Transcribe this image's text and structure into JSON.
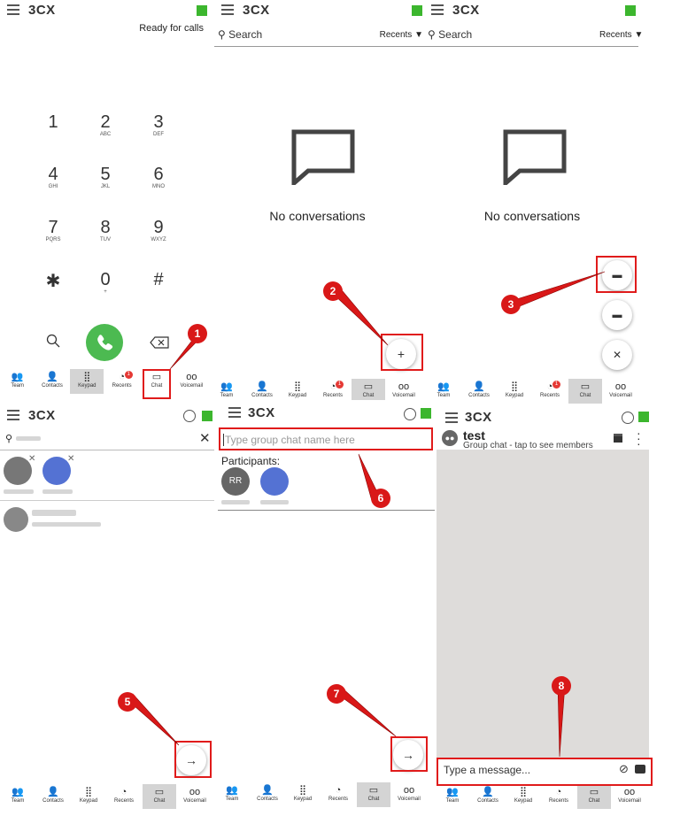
{
  "app": {
    "logo_text": "3CX"
  },
  "colors": {
    "presence": "#3cb62e",
    "call": "#4cba51",
    "marker": "#d91818",
    "avatar_blue": "#5472d3",
    "avatar_gray": "#666666"
  },
  "icons": {
    "menu": "hamburger-icon",
    "search": "search-icon",
    "back": "backspace-icon",
    "send": "arrow-right-icon"
  },
  "dialer": {
    "status": "Ready for calls",
    "keys": [
      {
        "n": "1",
        "l": ""
      },
      {
        "n": "2",
        "l": "ABC"
      },
      {
        "n": "3",
        "l": "DEF"
      },
      {
        "n": "4",
        "l": "GHI"
      },
      {
        "n": "5",
        "l": "JKL"
      },
      {
        "n": "6",
        "l": "MNO"
      },
      {
        "n": "7",
        "l": "PQRS"
      },
      {
        "n": "8",
        "l": "TUV"
      },
      {
        "n": "9",
        "l": "WXYZ"
      },
      {
        "n": "✱",
        "l": ""
      },
      {
        "n": "0",
        "l": "+"
      },
      {
        "n": "#",
        "l": ""
      }
    ]
  },
  "search": {
    "placeholder": "Search",
    "filter": "Recents"
  },
  "empty_state": "No conversations",
  "group": {
    "name_placeholder": "Type group chat name here",
    "participants_label": "Participants:",
    "avatar_initials": "RR"
  },
  "chat": {
    "title": "test",
    "subtitle": "Group chat - tap to see members",
    "message_placeholder": "Type a message..."
  },
  "nav": [
    "Team",
    "Contacts",
    "Keypad",
    "Recents",
    "Chat",
    "Voicemail"
  ],
  "badge_count": "1",
  "markers": [
    "1",
    "2",
    "3",
    "5",
    "6",
    "7",
    "8"
  ]
}
